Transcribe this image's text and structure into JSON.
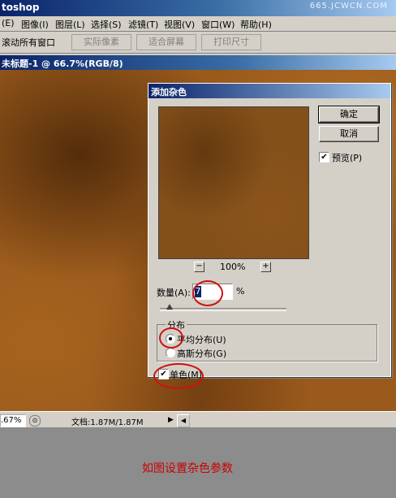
{
  "app": {
    "title": "toshop",
    "watermark": "665.JCWCN.COM"
  },
  "menu": [
    "(E)",
    "图像(I)",
    "图层(L)",
    "选择(S)",
    "滤镜(T)",
    "视图(V)",
    "窗口(W)",
    "帮助(H)"
  ],
  "options": {
    "scroll_all": "滚动所有窗口",
    "actual_pixels": "实际像素",
    "fit_screen": "适合屏幕",
    "print_size": "打印尺寸"
  },
  "document": {
    "title": "未标题-1 @ 66.7%(RGB/8)"
  },
  "status": {
    "zoom": ".67%",
    "doc_info": "文档:1.87M/1.87M"
  },
  "dialog": {
    "title": "添加杂色",
    "ok": "确定",
    "cancel": "取消",
    "preview_label": "预览(P)",
    "preview_checked": true,
    "zoom_out": "−",
    "zoom_level": "100%",
    "zoom_in": "+",
    "amount_label": "数量(A):",
    "amount_value": "7",
    "amount_unit": "%",
    "distribution_label": "分布",
    "uniform_label": "平均分布(U)",
    "gaussian_label": "高斯分布(G)",
    "selected_distribution": "uniform",
    "monochromatic_label": "单色(M)",
    "monochromatic_checked": true
  },
  "caption": "如图设置杂色参数",
  "colors": {
    "title_bar": "#0a246a",
    "canvas_brown": "#9a5a1c",
    "annotation_red": "#d01010",
    "caption_red": "#cc0000"
  }
}
